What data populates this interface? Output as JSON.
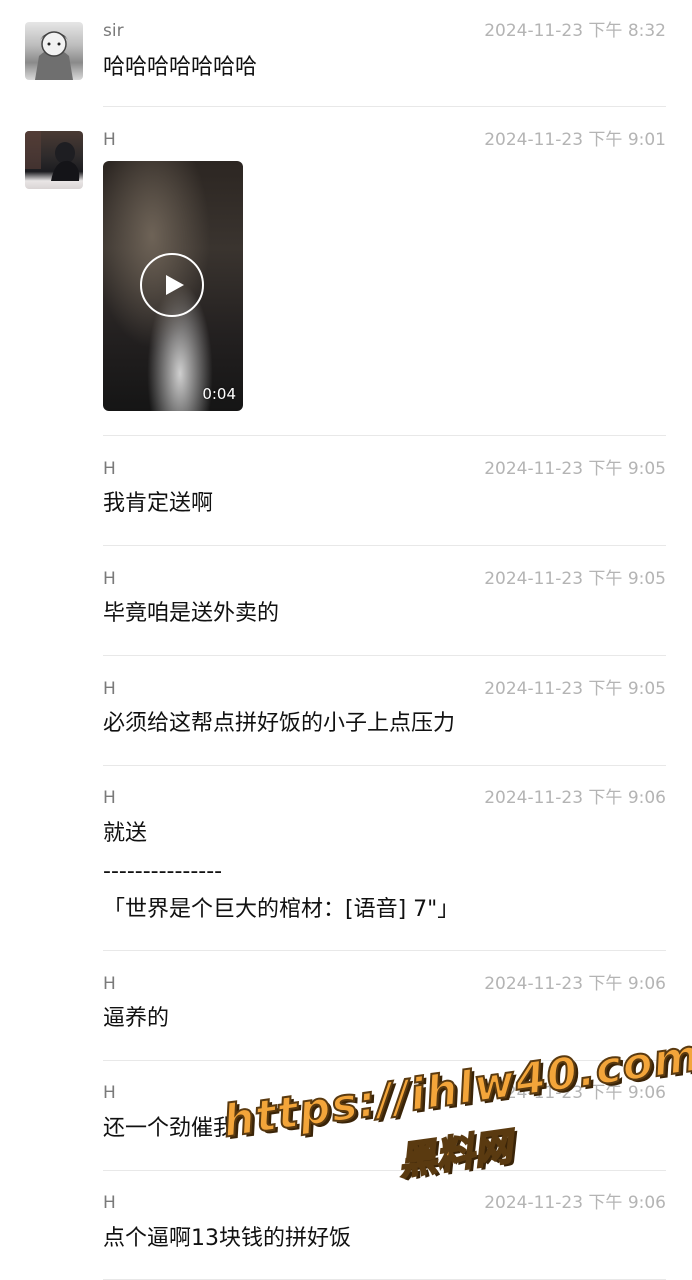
{
  "messages": [
    {
      "sender": "sir",
      "time": "2024-11-23 下午 8:32",
      "lines": [
        "哈哈哈哈哈哈哈"
      ]
    },
    {
      "sender": "H",
      "time": "2024-11-23 下午 9:01",
      "video": {
        "duration": "0:04"
      }
    },
    {
      "sender": "H",
      "time": "2024-11-23 下午 9:05",
      "lines": [
        "我肯定送啊"
      ]
    },
    {
      "sender": "H",
      "time": "2024-11-23 下午 9:05",
      "lines": [
        "毕竟咱是送外卖的"
      ]
    },
    {
      "sender": "H",
      "time": "2024-11-23 下午 9:05",
      "lines": [
        "必须给这帮点拼好饭的小子上点压力"
      ]
    },
    {
      "sender": "H",
      "time": "2024-11-23 下午 9:06",
      "lines": [
        "就送",
        "---------------",
        "「世界是个巨大的棺材：[语音] 7\"」"
      ]
    },
    {
      "sender": "H",
      "time": "2024-11-23 下午 9:06",
      "lines": [
        "逼养的"
      ]
    },
    {
      "sender": "H",
      "time": "2024-11-23 下午 9:06",
      "lines": [
        "还一个劲催我"
      ]
    },
    {
      "sender": "H",
      "time": "2024-11-23 下午 9:06",
      "lines": [
        "点个逼啊13块钱的拼好饭"
      ]
    }
  ],
  "watermark": {
    "url": "https://ihlw40.com",
    "text": "黑料网"
  },
  "icons": {
    "play": "play-icon",
    "avatar_sir": "manga-avatar",
    "avatar_h": "photo-avatar"
  },
  "colors": {
    "time": "#b4b4b4",
    "sender": "#7a7a7a",
    "divider": "#e8e8e8",
    "watermark": "#f3a53a"
  }
}
